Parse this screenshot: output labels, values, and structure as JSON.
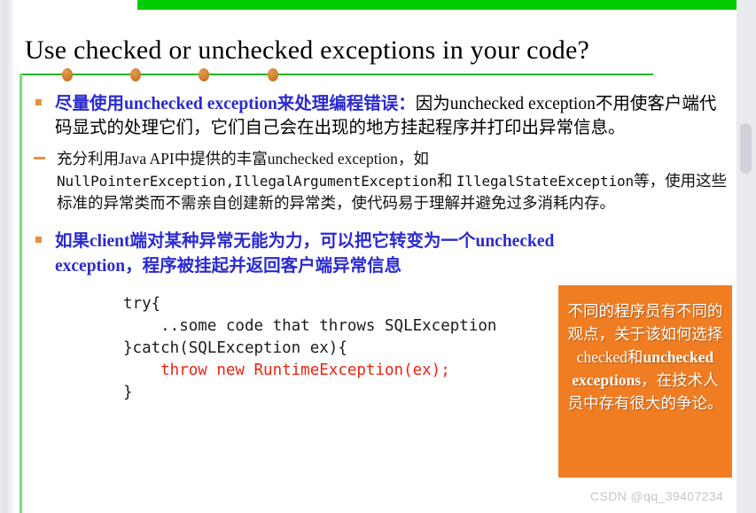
{
  "window": {
    "watermark": "CSDN @qq_39407234"
  },
  "slide": {
    "title": "Use checked or unchecked exceptions in your code?",
    "banner_color": "#00cc00",
    "accent_green": "#22b422",
    "accent_orange": "#e8913c",
    "heading_blue": "#2a2ad0",
    "callout_orange": "#f07d22",
    "code_red": "#ee2211",
    "divider_dots": 4,
    "bullets": [
      {
        "marker": "square",
        "lead": "尽量使用unchecked exception来处理编程错误：",
        "tail": "因为unchecked exception不用使客户端代码显式的处理它们，它们自己会在出现的地方挂起程序并打印出异常信息。",
        "sub": [
          {
            "marker": "dash",
            "text_before": "充分利用Java API中提供的丰富unchecked exception，如 ",
            "code_1": "NullPointerException",
            "sep_1": ",",
            "code_2": "IllegalArgumentException",
            "mid": "和 ",
            "code_3": "IllegalStateException",
            "text_after": "等，使用这些标准的异常类而不需亲自创建新的异常类，使代码易于理解并避免过多消耗内存。"
          }
        ]
      },
      {
        "marker": "square",
        "lead": "如果client端对某种异常无能为力，可以把它转变为一个unchecked exception，程序被挂起并返回客户端异常信息",
        "tail": ""
      }
    ],
    "code_block": {
      "line_1": "try{",
      "line_2": "    ..some code that throws SQLException",
      "line_3": "}catch(SQLException ex){",
      "line_4": "    throw new RuntimeException(ex);",
      "line_5": "}"
    },
    "callout": {
      "part_1": "不同的程序员有不同的观点，关于该如何选择checked和",
      "part_2": "unchecked exceptions",
      "part_3": "，在技术人员中存有很大的争论。"
    }
  }
}
